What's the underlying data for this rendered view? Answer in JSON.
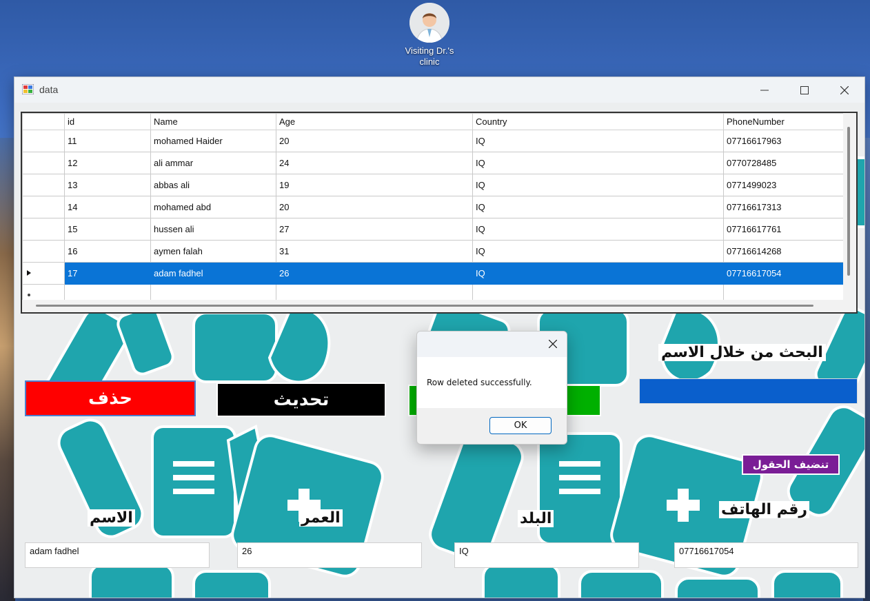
{
  "desktop": {
    "icon_label_line1": "Visiting Dr.'s",
    "icon_label_line2": "clinic"
  },
  "window": {
    "title": "data",
    "icon": "app-icon"
  },
  "grid": {
    "columns": [
      "id",
      "Name",
      "Age",
      "Country",
      "PhoneNumber"
    ],
    "rows": [
      {
        "id": "11",
        "name": "mohamed Haider",
        "age": "20",
        "country": "IQ",
        "phone": "07716617963"
      },
      {
        "id": "12",
        "name": "ali ammar",
        "age": "24",
        "country": "IQ",
        "phone": "0770728485"
      },
      {
        "id": "13",
        "name": "abbas ali",
        "age": "19",
        "country": "IQ",
        "phone": "0771499023"
      },
      {
        "id": "14",
        "name": "mohamed abd",
        "age": "20",
        "country": "IQ",
        "phone": "07716617313"
      },
      {
        "id": "15",
        "name": "hussen ali",
        "age": "27",
        "country": "IQ",
        "phone": "07716617761"
      },
      {
        "id": "16",
        "name": "aymen falah",
        "age": "31",
        "country": "IQ",
        "phone": "07716614268"
      },
      {
        "id": "17",
        "name": "adam fadhel",
        "age": "26",
        "country": "IQ",
        "phone": "07716617054"
      }
    ],
    "selected_row": 6,
    "selection_color": "#0a74d6"
  },
  "buttons": {
    "delete": "حذف",
    "update": "تحديث",
    "clear": "تنضيف الحقول"
  },
  "search": {
    "label": "البحث من خلال الاسم",
    "value": ""
  },
  "form": {
    "name_label": "الاسم",
    "age_label": "العمر",
    "country_label": "البلد",
    "phone_label": "رقم الهاتف",
    "name_value": "adam fadhel",
    "age_value": "26",
    "country_value": "IQ",
    "phone_value": "07716617054"
  },
  "dialog": {
    "message": "Row deleted successfully.",
    "ok_label": "OK"
  },
  "colors": {
    "delete": "#ff0000",
    "update": "#000000",
    "add": "#00b000",
    "clear": "#7a1d96",
    "search_box": "#0a5fcc",
    "art": "#1fa5ad"
  }
}
